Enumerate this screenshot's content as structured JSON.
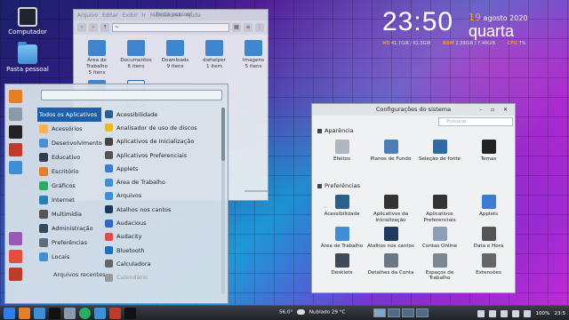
{
  "desktop": {
    "icons": [
      {
        "label": "Computador",
        "icon": "monitor-icon"
      },
      {
        "label": "Pasta pessoal",
        "icon": "home-folder-icon"
      }
    ]
  },
  "clock": {
    "time": "23:50",
    "day": "19",
    "month_year": "agosto 2020",
    "weekday": "quarta",
    "sysline": [
      {
        "key": "HD",
        "value": "41,7GiB / 62,5GiB"
      },
      {
        "key": "RAM",
        "value": "2,39GiB / 7,48GiB"
      },
      {
        "key": "CPU",
        "value": "7%"
      }
    ]
  },
  "file_manager": {
    "title": "Pasta pessoal",
    "menu": [
      "Arquivo",
      "Editar",
      "Exibir",
      "Ir",
      "Marcadores",
      "Ajuda"
    ],
    "path": "~",
    "items": [
      {
        "name": "Área de Trabalho",
        "sub": "5 itens",
        "icon": "desktop-folder-icon"
      },
      {
        "name": "Documentos",
        "sub": "6 itens",
        "icon": "documents-folder-icon"
      },
      {
        "name": "Downloads",
        "sub": "9 itens",
        "icon": "downloads-folder-icon"
      },
      {
        "name": "dwhelper",
        "sub": "1 item",
        "icon": "folder-icon"
      },
      {
        "name": "Imagens",
        "sub": "5 itens",
        "icon": "images-folder-icon"
      },
      {
        "name": "Público",
        "sub": "0 item",
        "icon": "public-folder-icon"
      },
      {
        "name": "weather@mockturtl.pot",
        "sub": "53,3 kB",
        "icon": "text-file-icon"
      }
    ]
  },
  "app_menu": {
    "categories": [
      {
        "label": "Todos os Aplicativos",
        "color": "#1e5fa8"
      },
      {
        "label": "Acessórios",
        "color": "#ffb347"
      },
      {
        "label": "Desenvolvimento",
        "color": "#4a90d9"
      },
      {
        "label": "Educativo",
        "color": "#2c3e50"
      },
      {
        "label": "Escritório",
        "color": "#e67e22"
      },
      {
        "label": "Gráficos",
        "color": "#27ae60"
      },
      {
        "label": "Internet",
        "color": "#2980b9"
      },
      {
        "label": "Multimídia",
        "color": "#555555"
      },
      {
        "label": "Administração",
        "color": "#34495e"
      },
      {
        "label": "Preferências",
        "color": "#5d6d7e"
      },
      {
        "label": "Locais",
        "color": "#3f8fd6"
      }
    ],
    "recent_label": "Arquivos recentes",
    "apps": [
      {
        "label": "Acessibilidade",
        "color": "#2c5f8a"
      },
      {
        "label": "Analisador de uso de discos",
        "color": "#e8b923"
      },
      {
        "label": "Aplicativos de Inicialização",
        "color": "#444444"
      },
      {
        "label": "Aplicativos Preferenciais",
        "color": "#555555"
      },
      {
        "label": "Applets",
        "color": "#3a7bd5"
      },
      {
        "label": "Área de Trabalho",
        "color": "#3f8fd6"
      },
      {
        "label": "Arquivos",
        "color": "#3f8fd6"
      },
      {
        "label": "Atalhos nos cantos",
        "color": "#1e3a5f"
      },
      {
        "label": "Audacious",
        "color": "#3366cc"
      },
      {
        "label": "Audacity",
        "color": "#e54b4b"
      },
      {
        "label": "Bluetooth",
        "color": "#1e6fc2"
      },
      {
        "label": "Calculadora",
        "color": "#666666"
      },
      {
        "label": "Calendário",
        "color": "#999999",
        "dim": true
      }
    ]
  },
  "settings": {
    "title": "Configurações do sistema",
    "search_placeholder": "Procurar",
    "window_buttons": "– ▫ ✕",
    "sections": [
      {
        "label": "Aparência",
        "items": [
          {
            "label": "Efeitos",
            "color": "#b0b7bf"
          },
          {
            "label": "Planos de Fundo",
            "color": "#4a7fb5"
          },
          {
            "label": "Seleção de fonte",
            "color": "#2d6ca2"
          },
          {
            "label": "Temas",
            "color": "#222222"
          }
        ]
      },
      {
        "label": "Preferências",
        "items": [
          {
            "label": "Acessibilidade",
            "color": "#2c5f8a"
          },
          {
            "label": "Aplicativos da Inicialização",
            "color": "#333333"
          },
          {
            "label": "Aplicativos Preferenciais",
            "color": "#333333"
          },
          {
            "label": "Applets",
            "color": "#3a7bd5"
          },
          {
            "label": "Área de Trabalho",
            "color": "#3f8fd6"
          },
          {
            "label": "Atalhos nos cantos",
            "color": "#1e3a5f"
          },
          {
            "label": "Contas Online",
            "color": "#8aa0b8"
          },
          {
            "label": "Data e Hora",
            "color": "#555555"
          },
          {
            "label": "Desklets",
            "color": "#3d4a57"
          },
          {
            "label": "Detalhes da Conta",
            "color": "#6b7785"
          },
          {
            "label": "Espaços de Trabalho",
            "color": "#7a8794"
          },
          {
            "label": "Extensões",
            "color": "#666666"
          }
        ]
      }
    ]
  },
  "taskbar": {
    "weather_temp": "56.0°",
    "weather_text": "Nublado 29 °C",
    "battery": "100%",
    "time": "23:5"
  }
}
